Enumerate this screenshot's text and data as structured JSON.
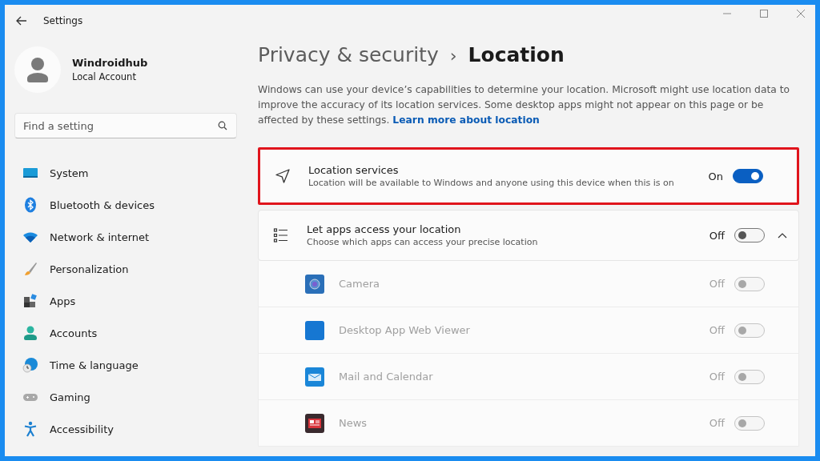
{
  "window": {
    "title": "Settings"
  },
  "account": {
    "name": "Windroidhub",
    "type": "Local Account"
  },
  "search": {
    "placeholder": "Find a setting"
  },
  "sidebar": {
    "items": [
      {
        "label": "System"
      },
      {
        "label": "Bluetooth & devices"
      },
      {
        "label": "Network & internet"
      },
      {
        "label": "Personalization"
      },
      {
        "label": "Apps"
      },
      {
        "label": "Accounts"
      },
      {
        "label": "Time & language"
      },
      {
        "label": "Gaming"
      },
      {
        "label": "Accessibility"
      }
    ]
  },
  "breadcrumb": {
    "parent": "Privacy & security",
    "separator": "›",
    "current": "Location"
  },
  "description": {
    "text": "Windows can use your device’s capabilities to determine your location. Microsoft might use location data to improve the accuracy of its location services. Some desktop apps might not appear on this page or be affected by these settings.",
    "link": "Learn more about location"
  },
  "location_services": {
    "title": "Location services",
    "subtitle": "Location will be available to Windows and anyone using this device when this is on",
    "state_label": "On",
    "on": true,
    "highlighted": true
  },
  "app_access": {
    "title": "Let apps access your location",
    "subtitle": "Choose which apps can access your precise location",
    "state_label": "Off",
    "on": false,
    "expanded": true,
    "apps": [
      {
        "name": "Camera",
        "state_label": "Off",
        "on": false,
        "disabled": true
      },
      {
        "name": "Desktop App Web Viewer",
        "state_label": "Off",
        "on": false,
        "disabled": true
      },
      {
        "name": "Mail and Calendar",
        "state_label": "Off",
        "on": false,
        "disabled": true
      },
      {
        "name": "News",
        "state_label": "Off",
        "on": false,
        "disabled": true
      }
    ]
  }
}
